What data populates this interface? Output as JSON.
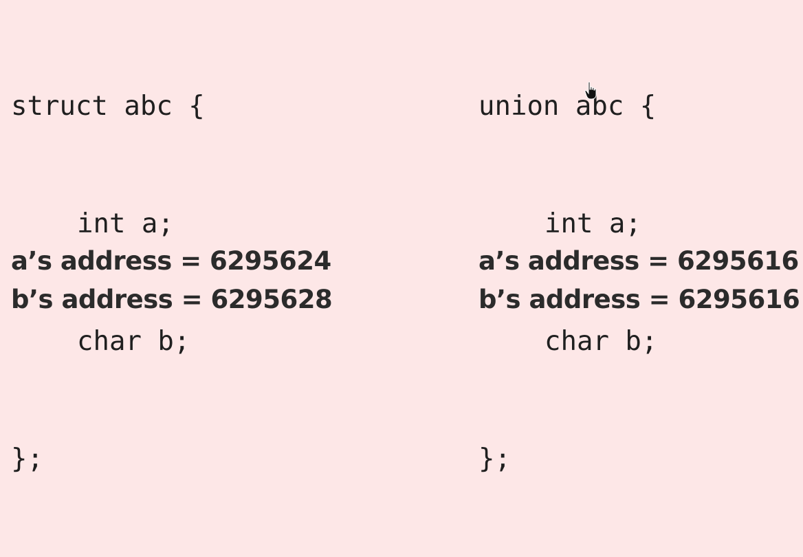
{
  "struct_panel": {
    "code_lines": [
      "struct abc {",
      "int a;",
      "char b;",
      "};"
    ],
    "a_address": "a’s address = 6295624",
    "b_address": "b’s address = 6295628"
  },
  "union_panel": {
    "code_lines": [
      "union abc {",
      "int a;",
      "char b;",
      "};"
    ],
    "a_address": "a’s address = 6295616",
    "b_address": "b’s address = 6295616"
  },
  "colors": {
    "background": "#fde7e7",
    "text": "#1f1f1f"
  },
  "cursor_icon": "hand-pointer-icon"
}
